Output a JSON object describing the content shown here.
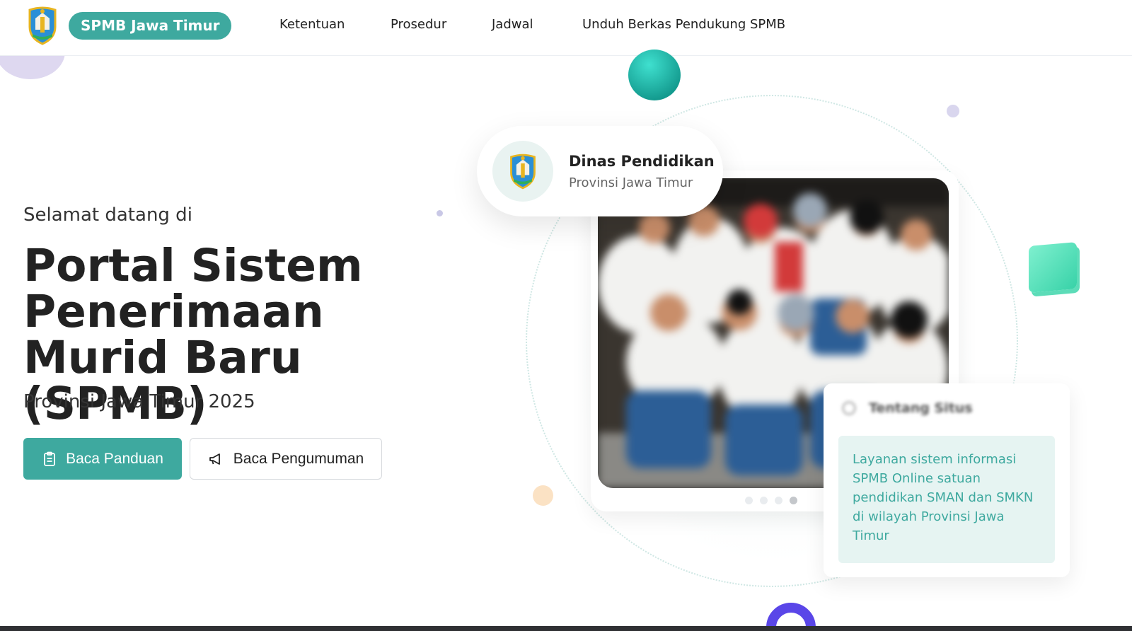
{
  "header": {
    "brand": "SPMB Jawa Timur",
    "nav": [
      "Ketentuan",
      "Prosedur",
      "Jadwal",
      "Unduh Berkas Pendukung SPMB"
    ]
  },
  "hero": {
    "welcome": "Selamat datang di",
    "title": "Portal Sistem Penerimaan Murid Baru (SPMB)",
    "subtitle": "Provinsi Jawa Timur 2025",
    "primary_button": "Baca Panduan",
    "secondary_button": "Baca Pengumuman"
  },
  "agency_badge": {
    "title": "Dinas Pendidikan",
    "subtitle": "Provinsi Jawa Timur"
  },
  "about_card": {
    "title": "Tentang Situs",
    "body": "Layanan sistem informasi SPMB Online satuan pendidikan SMAN dan SMKN di wilayah Provinsi Jawa Timur"
  },
  "carousel": {
    "slide_count": 4,
    "active_index": 3
  },
  "colors": {
    "primary": "#3ea99f",
    "accent_teal": "#139a8e",
    "accent_green": "#38d2a8",
    "accent_purple": "#5a46e8"
  },
  "icons": {
    "primary_button": "clipboard-icon",
    "secondary_button": "megaphone-icon",
    "about": "info-icon"
  }
}
